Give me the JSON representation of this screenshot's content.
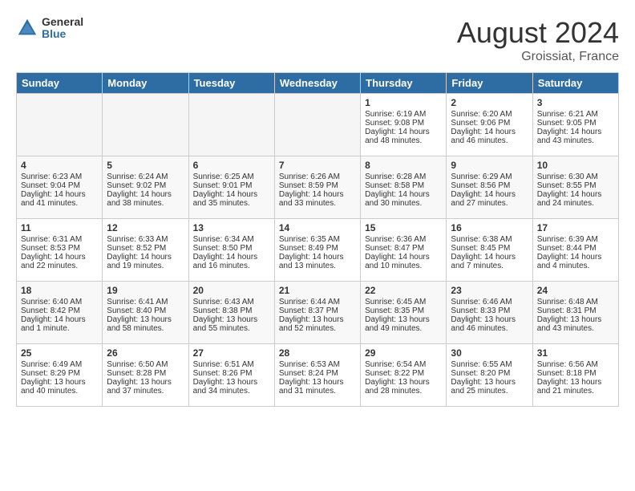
{
  "logo": {
    "general": "General",
    "blue": "Blue"
  },
  "title": {
    "month_year": "August 2024",
    "location": "Groissiat, France"
  },
  "headers": [
    "Sunday",
    "Monday",
    "Tuesday",
    "Wednesday",
    "Thursday",
    "Friday",
    "Saturday"
  ],
  "weeks": [
    [
      {
        "day": "",
        "text": "",
        "empty": true
      },
      {
        "day": "",
        "text": "",
        "empty": true
      },
      {
        "day": "",
        "text": "",
        "empty": true
      },
      {
        "day": "",
        "text": "",
        "empty": true
      },
      {
        "day": "1",
        "text": "Sunrise: 6:19 AM\nSunset: 9:08 PM\nDaylight: 14 hours and 48 minutes."
      },
      {
        "day": "2",
        "text": "Sunrise: 6:20 AM\nSunset: 9:06 PM\nDaylight: 14 hours and 46 minutes."
      },
      {
        "day": "3",
        "text": "Sunrise: 6:21 AM\nSunset: 9:05 PM\nDaylight: 14 hours and 43 minutes."
      }
    ],
    [
      {
        "day": "4",
        "text": "Sunrise: 6:23 AM\nSunset: 9:04 PM\nDaylight: 14 hours and 41 minutes."
      },
      {
        "day": "5",
        "text": "Sunrise: 6:24 AM\nSunset: 9:02 PM\nDaylight: 14 hours and 38 minutes."
      },
      {
        "day": "6",
        "text": "Sunrise: 6:25 AM\nSunset: 9:01 PM\nDaylight: 14 hours and 35 minutes."
      },
      {
        "day": "7",
        "text": "Sunrise: 6:26 AM\nSunset: 8:59 PM\nDaylight: 14 hours and 33 minutes."
      },
      {
        "day": "8",
        "text": "Sunrise: 6:28 AM\nSunset: 8:58 PM\nDaylight: 14 hours and 30 minutes."
      },
      {
        "day": "9",
        "text": "Sunrise: 6:29 AM\nSunset: 8:56 PM\nDaylight: 14 hours and 27 minutes."
      },
      {
        "day": "10",
        "text": "Sunrise: 6:30 AM\nSunset: 8:55 PM\nDaylight: 14 hours and 24 minutes."
      }
    ],
    [
      {
        "day": "11",
        "text": "Sunrise: 6:31 AM\nSunset: 8:53 PM\nDaylight: 14 hours and 22 minutes."
      },
      {
        "day": "12",
        "text": "Sunrise: 6:33 AM\nSunset: 8:52 PM\nDaylight: 14 hours and 19 minutes."
      },
      {
        "day": "13",
        "text": "Sunrise: 6:34 AM\nSunset: 8:50 PM\nDaylight: 14 hours and 16 minutes."
      },
      {
        "day": "14",
        "text": "Sunrise: 6:35 AM\nSunset: 8:49 PM\nDaylight: 14 hours and 13 minutes."
      },
      {
        "day": "15",
        "text": "Sunrise: 6:36 AM\nSunset: 8:47 PM\nDaylight: 14 hours and 10 minutes."
      },
      {
        "day": "16",
        "text": "Sunrise: 6:38 AM\nSunset: 8:45 PM\nDaylight: 14 hours and 7 minutes."
      },
      {
        "day": "17",
        "text": "Sunrise: 6:39 AM\nSunset: 8:44 PM\nDaylight: 14 hours and 4 minutes."
      }
    ],
    [
      {
        "day": "18",
        "text": "Sunrise: 6:40 AM\nSunset: 8:42 PM\nDaylight: 14 hours and 1 minute."
      },
      {
        "day": "19",
        "text": "Sunrise: 6:41 AM\nSunset: 8:40 PM\nDaylight: 13 hours and 58 minutes."
      },
      {
        "day": "20",
        "text": "Sunrise: 6:43 AM\nSunset: 8:38 PM\nDaylight: 13 hours and 55 minutes."
      },
      {
        "day": "21",
        "text": "Sunrise: 6:44 AM\nSunset: 8:37 PM\nDaylight: 13 hours and 52 minutes."
      },
      {
        "day": "22",
        "text": "Sunrise: 6:45 AM\nSunset: 8:35 PM\nDaylight: 13 hours and 49 minutes."
      },
      {
        "day": "23",
        "text": "Sunrise: 6:46 AM\nSunset: 8:33 PM\nDaylight: 13 hours and 46 minutes."
      },
      {
        "day": "24",
        "text": "Sunrise: 6:48 AM\nSunset: 8:31 PM\nDaylight: 13 hours and 43 minutes."
      }
    ],
    [
      {
        "day": "25",
        "text": "Sunrise: 6:49 AM\nSunset: 8:29 PM\nDaylight: 13 hours and 40 minutes."
      },
      {
        "day": "26",
        "text": "Sunrise: 6:50 AM\nSunset: 8:28 PM\nDaylight: 13 hours and 37 minutes."
      },
      {
        "day": "27",
        "text": "Sunrise: 6:51 AM\nSunset: 8:26 PM\nDaylight: 13 hours and 34 minutes."
      },
      {
        "day": "28",
        "text": "Sunrise: 6:53 AM\nSunset: 8:24 PM\nDaylight: 13 hours and 31 minutes."
      },
      {
        "day": "29",
        "text": "Sunrise: 6:54 AM\nSunset: 8:22 PM\nDaylight: 13 hours and 28 minutes."
      },
      {
        "day": "30",
        "text": "Sunrise: 6:55 AM\nSunset: 8:20 PM\nDaylight: 13 hours and 25 minutes."
      },
      {
        "day": "31",
        "text": "Sunrise: 6:56 AM\nSunset: 8:18 PM\nDaylight: 13 hours and 21 minutes."
      }
    ]
  ]
}
